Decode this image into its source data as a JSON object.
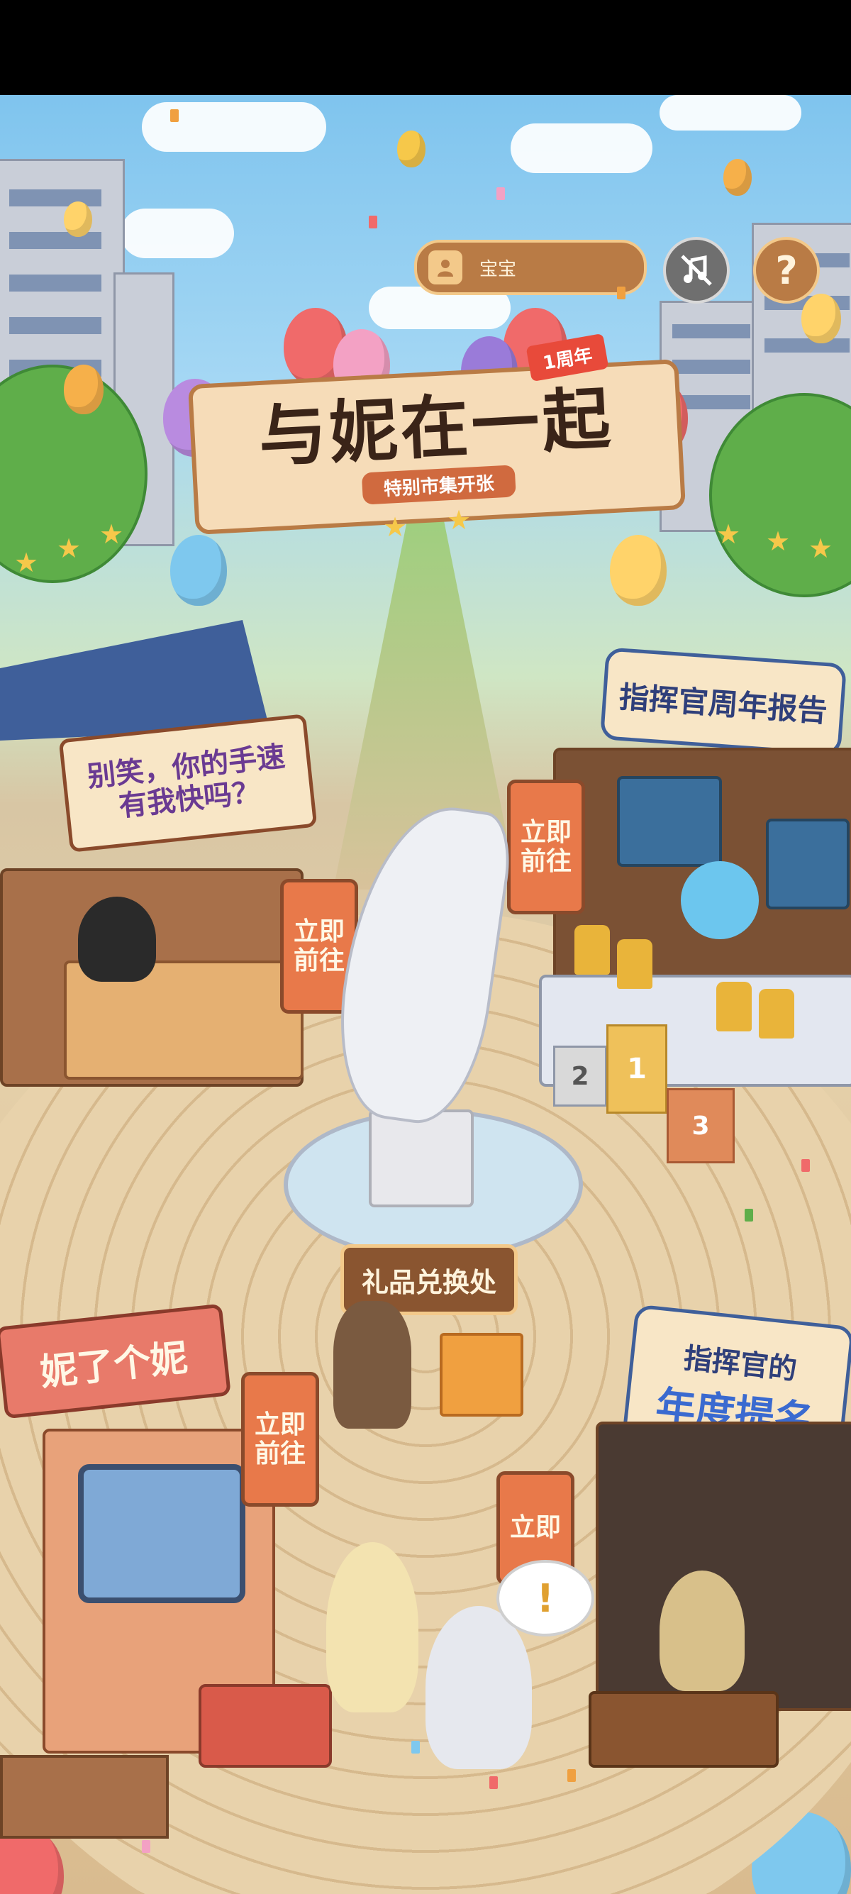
{
  "hud": {
    "username": "宝宝",
    "music_icon": "music-muted-icon",
    "help_icon": "question-icon"
  },
  "title": {
    "main": "与妮在一起",
    "subtitle": "特别市集开张",
    "anniversary_badge": "1周年"
  },
  "booths": {
    "handspeed": {
      "title": "别笑，你的手速有我快吗？",
      "title_line1": "别笑，你的手速",
      "title_line2": "有我快吗？",
      "go_line1": "立即",
      "go_line2": "前往"
    },
    "report": {
      "title": "指挥官周年报告",
      "go_line1": "立即",
      "go_line2": "前往"
    },
    "gift": {
      "title": "礼品兑换处"
    },
    "arcade": {
      "title": "妮了个妮",
      "go_line1": "立即",
      "go_line2": "前往"
    },
    "nomination": {
      "title_line1": "指挥官的",
      "title_line2": "年度提名",
      "go_line1": "立即",
      "go_line2": ""
    }
  },
  "podium": {
    "first": "1",
    "second": "2",
    "third": "3"
  },
  "npc_bubble": "!",
  "colors": {
    "sign_orange": "#e8794a",
    "hud_brown": "#b97b45",
    "sky": "#8fcdf0",
    "plaza": "#e6cfa6"
  }
}
